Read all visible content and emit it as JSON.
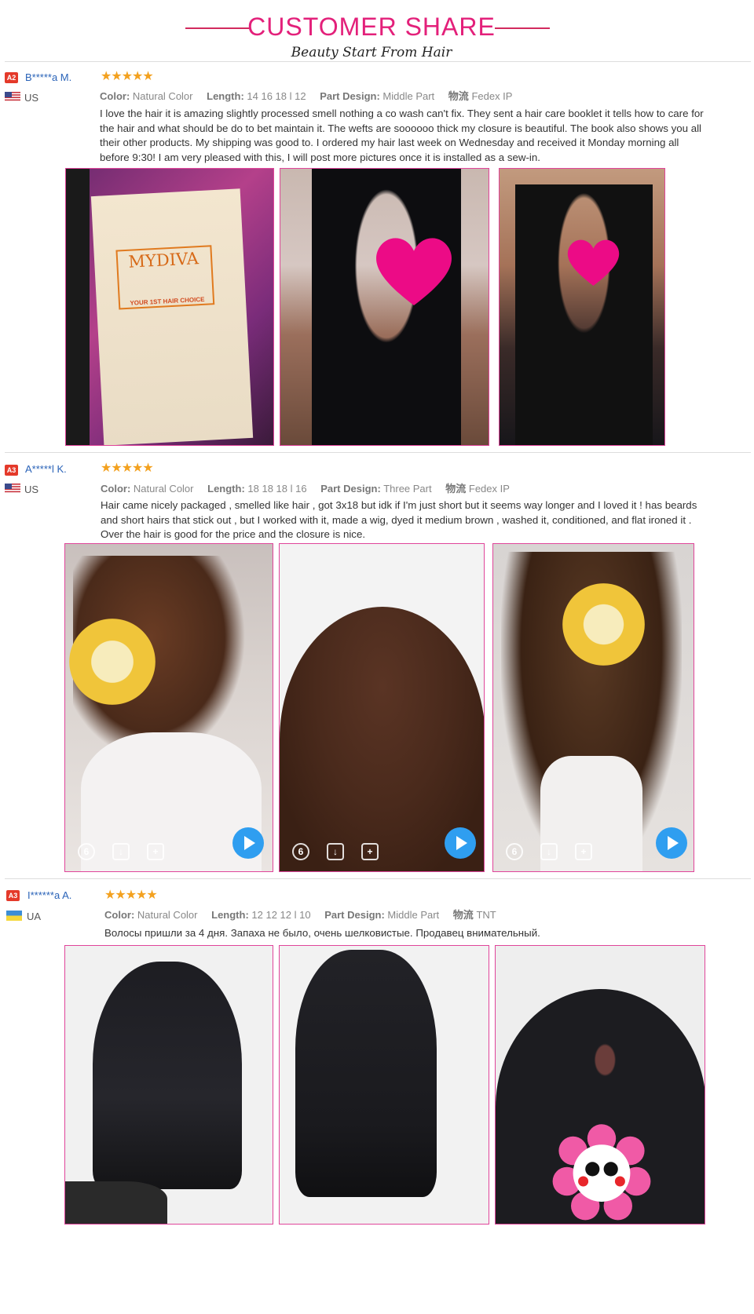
{
  "header": {
    "title": "CUSTOMER SHARE",
    "subtitle": "Beauty Start From Hair",
    "accent": "#e3207a"
  },
  "reviews": [
    {
      "badge": "A2",
      "username": "B*****a M.",
      "country": "US",
      "stars": "★★★★★",
      "color_label": "Color:",
      "color": "Natural Color",
      "length_label": "Length:",
      "length": "14 16 18 l 12",
      "part_label": "Part Design:",
      "part": "Middle Part",
      "ship_label": "物流",
      "ship": "Fedex IP",
      "text": "I love the hair it is amazing slightly processed smell nothing a co wash can't fix. They sent a hair care booklet it tells how to care for the hair and what should be do to bet maintain it. The wefts are soooooo thick my closure is beautiful. The book also shows you all their other products. My shipping was good to. I ordered my hair last week on Wednesday and received it Monday morning all before 9:30! I am very pleased with this, I will post more pictures once it is installed as a sew-in.",
      "box_brand": "MYDIVA",
      "box_tagline": "YOUR 1ST HAIR CHOICE"
    },
    {
      "badge": "A3",
      "username": "A*****l K.",
      "country": "US",
      "stars": "★★★★★",
      "color_label": "Color:",
      "color": "Natural Color",
      "length_label": "Length:",
      "length": "18 18 18 l 16",
      "part_label": "Part Design:",
      "part": "Three Part",
      "ship_label": "物流",
      "ship": "Fedex IP",
      "text": "Hair came nicely packaged , smelled like hair , got 3x18 but idk if I'm just short but it seems way longer and I loved it ! has beards and short hairs that stick out , but I worked with it, made a wig, dyed it medium brown , washed it, conditioned, and flat ironed it . Over the hair is good for the price and the closure is nice.",
      "snap_timer": "6"
    },
    {
      "badge": "A3",
      "username": "I******a A.",
      "country": "UA",
      "stars": "★★★★★",
      "color_label": "Color:",
      "color": "Natural Color",
      "length_label": "Length:",
      "length": "12 12 12 l 10",
      "part_label": "Part Design:",
      "part": "Middle Part",
      "ship_label": "物流",
      "ship": "TNT",
      "text": "Волосы пришли за 4 дня. Запаха не было, очень шелковистые. Продавец внимательный."
    }
  ]
}
